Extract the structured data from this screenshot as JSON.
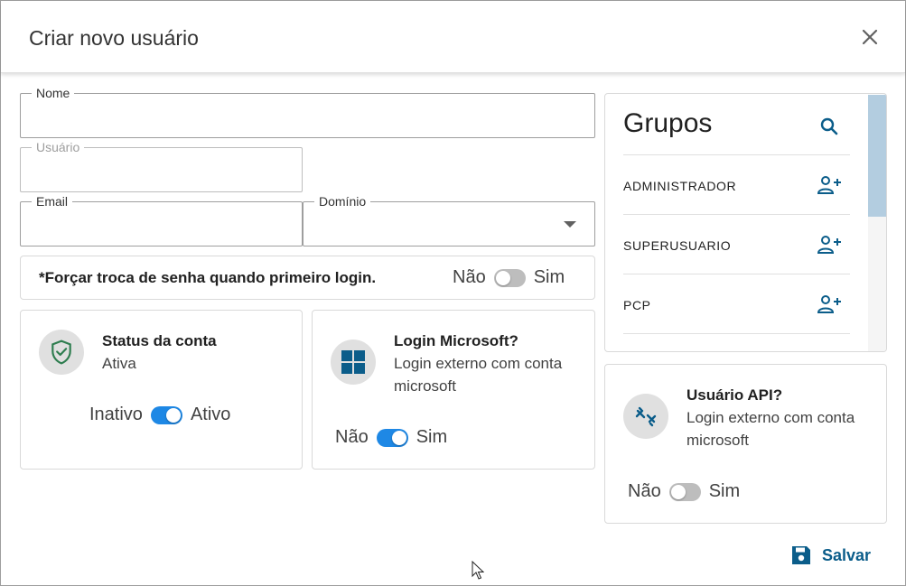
{
  "dialog": {
    "title": "Criar novo usuário"
  },
  "form": {
    "nome_label": "Nome",
    "usuario_label": "Usuário",
    "email_label": "Email",
    "dominio_label": "Domínio"
  },
  "force_password": {
    "label": "*Forçar troca de senha quando primeiro login.",
    "off_label": "Não",
    "on_label": "Sim",
    "enabled": false
  },
  "status_card": {
    "title": "Status da conta",
    "subtitle": "Ativa",
    "off_label": "Inativo",
    "on_label": "Ativo",
    "enabled": true
  },
  "microsoft_card": {
    "title": "Login Microsoft?",
    "subtitle": "Login externo com conta microsoft",
    "off_label": "Não",
    "on_label": "Sim",
    "enabled": true
  },
  "groups": {
    "title": "Grupos",
    "items": [
      {
        "label": "ADMINISTRADOR"
      },
      {
        "label": "SUPERUSUARIO"
      },
      {
        "label": "PCP"
      }
    ]
  },
  "api_card": {
    "title": "Usuário API?",
    "subtitle": "Login externo com conta microsoft",
    "off_label": "Não",
    "on_label": "Sim",
    "enabled": false
  },
  "actions": {
    "save_label": "Salvar"
  },
  "colors": {
    "accent": "#1e88e5",
    "primary_dark": "#0b5d8a",
    "shield": "#2e7d4f",
    "windows": "#0b5d8a"
  }
}
